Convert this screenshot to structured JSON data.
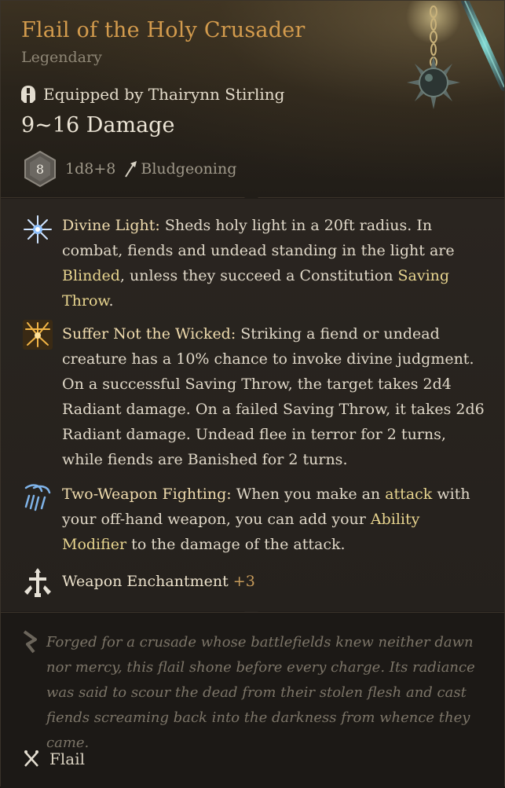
{
  "item": {
    "name": "Flail of the Holy Crusader",
    "rarity": "Legendary",
    "equipped_by": "Equipped by Thairynn Stirling",
    "damage_range": "9~16 Damage",
    "dice_value": "8",
    "dice_formula": "1d8+8",
    "damage_type": "Bludgeoning"
  },
  "properties": [
    {
      "icon": "divine-light-icon",
      "name": "Divine Light:",
      "text1": " Sheds holy light in a 20ft radius. In combat, fiends and undead standing in the light are ",
      "kw1": "Blinded",
      "text2": ", unless they succeed a Constitution ",
      "kw2": "Saving Throw",
      "text3": "."
    },
    {
      "icon": "suffer-not-the-wicked-icon",
      "name": "Suffer Not the Wicked:",
      "text1": " Striking a fiend or undead creature has a 10% chance to invoke divine judgment. On a successful Saving Throw, the target takes 2d4 Radiant damage. On a failed Saving Throw, it takes 2d6 Radiant damage. Undead flee in terror for 2 turns, while fiends are Banished for 2 turns."
    },
    {
      "icon": "two-weapon-fighting-icon",
      "name": "Two-Weapon Fighting:",
      "text1": " When you make an ",
      "kw1": "attack",
      "text2": " with your off-hand weapon, you can add your ",
      "kw2": "Ability Modifier",
      "text3": " to the damage of the attack."
    }
  ],
  "enchantment": {
    "label": "Weapon Enchantment",
    "bonus": "+3"
  },
  "lore": "Forged for a crusade whose battlefields knew neither dawn nor mercy, this flail shone before every charge. Its radiance was said to scour the dead from their stolen flesh and cast fiends screaming back into the darkness from whence they came.",
  "weapon_type": "Flail",
  "colors": {
    "title": "#d39b4d",
    "keyword": "#e8d58f",
    "property_name": "#f0dcae",
    "enchant_bonus": "#c79b5a",
    "lore": "#7c7568"
  }
}
